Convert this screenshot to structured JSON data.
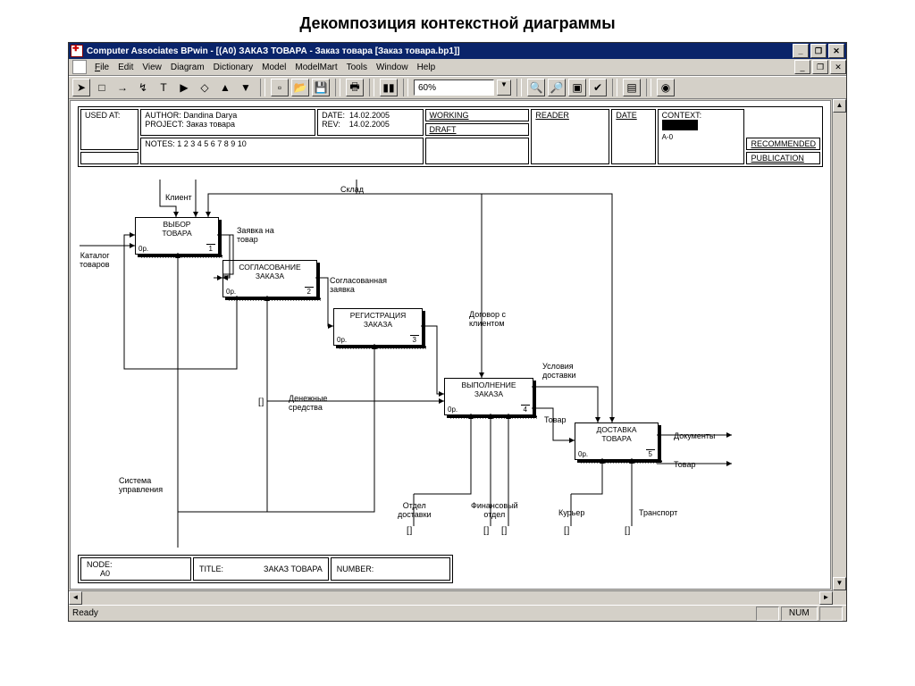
{
  "page_title": "Декомпозиция контекстной диаграммы",
  "titlebar": "Computer Associates BPwin - [(A0) ЗАКАЗ ТОВАРА  - Заказ товара  [Заказ товара.bp1]]",
  "menu": {
    "file": "File",
    "edit": "Edit",
    "view": "View",
    "diagram": "Diagram",
    "dictionary": "Dictionary",
    "model": "Model",
    "modelmart": "ModelMart",
    "tools": "Tools",
    "window": "Window",
    "help": "Help"
  },
  "zoom": "60%",
  "header": {
    "used_at": "USED AT:",
    "author_lbl": "AUTHOR:",
    "author": "Dandina Darya",
    "project_lbl": "PROJECT:",
    "project": "Заказ товара",
    "date_lbl": "DATE:",
    "date": "14.02.2005",
    "rev_lbl": "REV:",
    "rev": "14.02.2005",
    "notes_lbl": "NOTES:",
    "notes": "1  2  3  4  5  6  7  8  9  10",
    "working": "WORKING",
    "draft": "DRAFT",
    "recommended": "RECOMMENDED",
    "publication": "PUBLICATION",
    "reader": "READER",
    "date2": "DATE",
    "context": "CONTEXT:",
    "context_code": "A-0"
  },
  "footer": {
    "node_lbl": "NODE:",
    "node": "A0",
    "title_lbl": "TITLE:",
    "title": "ЗАКАЗ ТОВАРА",
    "number_lbl": "NUMBER:"
  },
  "blocks": {
    "b1": {
      "title": "ВЫБОР\nТОВАРА",
      "cost": "0р.",
      "num": "1"
    },
    "b2": {
      "title": "СОГЛАСОВАНИЕ\nЗАКАЗА",
      "cost": "0р.",
      "num": "2"
    },
    "b3": {
      "title": "РЕГИСТРАЦИЯ\nЗАКАЗА",
      "cost": "0р.",
      "num": "3"
    },
    "b4": {
      "title": "ВЫПОЛНЕНИЕ\nЗАКАЗА",
      "cost": "0р.",
      "num": "4"
    },
    "b5": {
      "title": "ДОСТАВКА\nТОВАРА",
      "cost": "0р.",
      "num": "5"
    }
  },
  "labels": {
    "klient": "Клиент",
    "sklad": "Склад",
    "katalog": "Каталог\nтоваров",
    "zayavka": "Заявка на\nтовар",
    "soglas": "Согласованная\nзаявка",
    "dogovor": "Договор с\nклиентом",
    "usloviya": "Условия\nдоставки",
    "dokumenty": "Документы",
    "tovar_out": "Товар",
    "tovar": "Товар",
    "denezh": "Денежные\nсредства",
    "sistema": "Система\nуправления",
    "otdel": "Отдел\nдоставки",
    "finans": "Финансовый\nотдел",
    "kurier": "Курьер",
    "transport": "Транспорт"
  },
  "status": {
    "ready": "Ready",
    "num": "NUM"
  }
}
